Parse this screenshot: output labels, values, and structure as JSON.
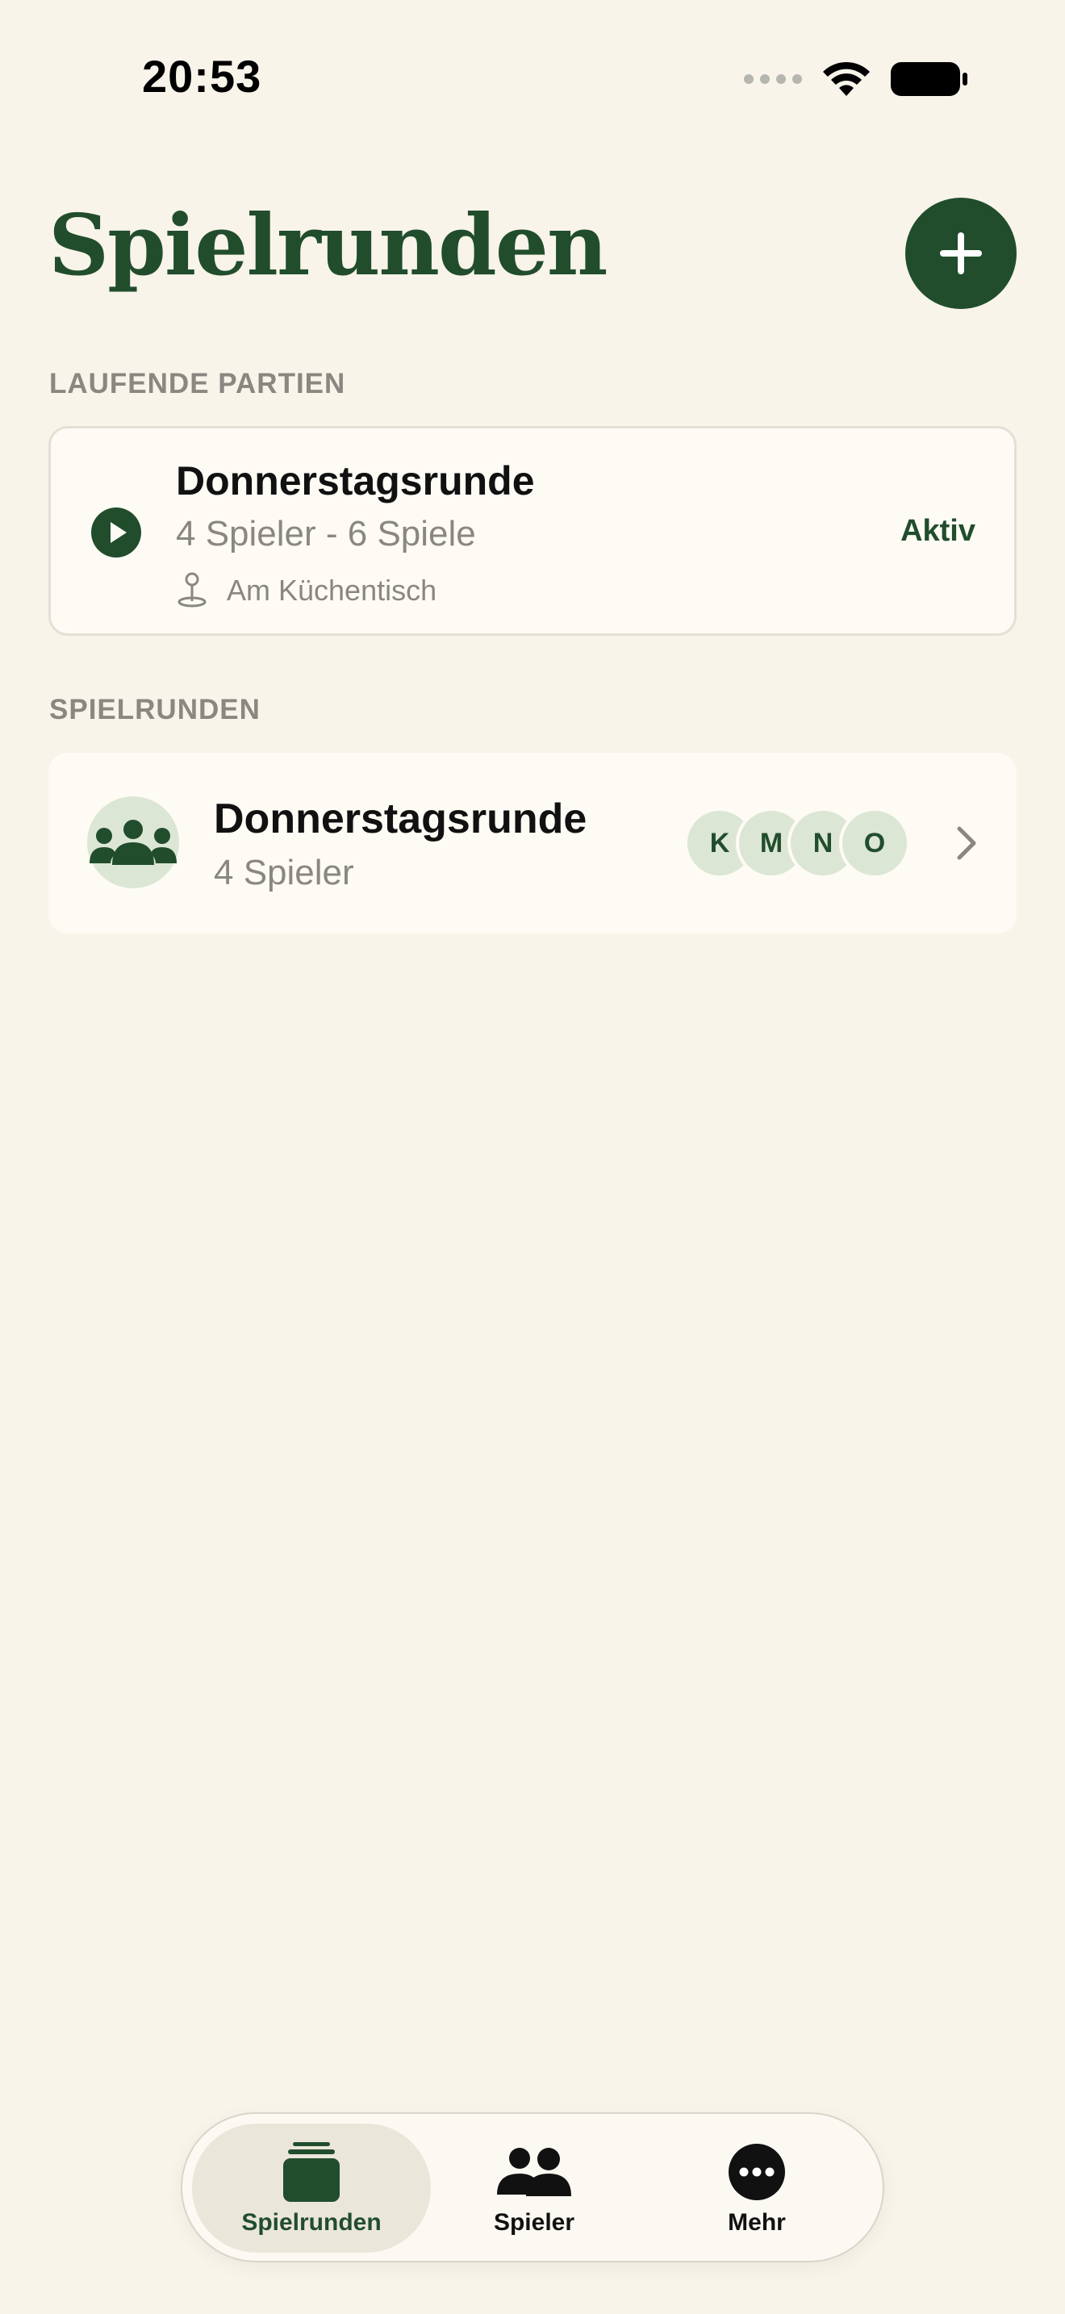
{
  "status_bar": {
    "time": "20:53"
  },
  "header": {
    "title": "Spielrunden",
    "add_icon": "plus-icon"
  },
  "sections": {
    "running": {
      "label": "LAUFENDE PARTIEN",
      "card": {
        "title": "Donnerstagsrunde",
        "subtitle": "4 Spieler - 6 Spiele",
        "location": "Am Küchentisch",
        "status": "Aktiv",
        "icon": "play-circle-icon"
      }
    },
    "groups": {
      "label": "SPIELRUNDEN",
      "items": [
        {
          "title": "Donnerstagsrunde",
          "subtitle": "4 Spieler",
          "initials": [
            "K",
            "M",
            "N",
            "O"
          ]
        }
      ]
    }
  },
  "tab_bar": {
    "tabs": [
      {
        "label": "Spielrunden",
        "icon": "cards-stack-icon",
        "selected": true
      },
      {
        "label": "Spieler",
        "icon": "people-icon",
        "selected": false
      },
      {
        "label": "Mehr",
        "icon": "more-icon",
        "selected": false
      }
    ]
  },
  "colors": {
    "background": "#f8f4ea",
    "accent": "#214d2c",
    "card": "#fdfbf4",
    "secondary_text": "#8a8780",
    "avatar_bg": "#dce6d4"
  }
}
